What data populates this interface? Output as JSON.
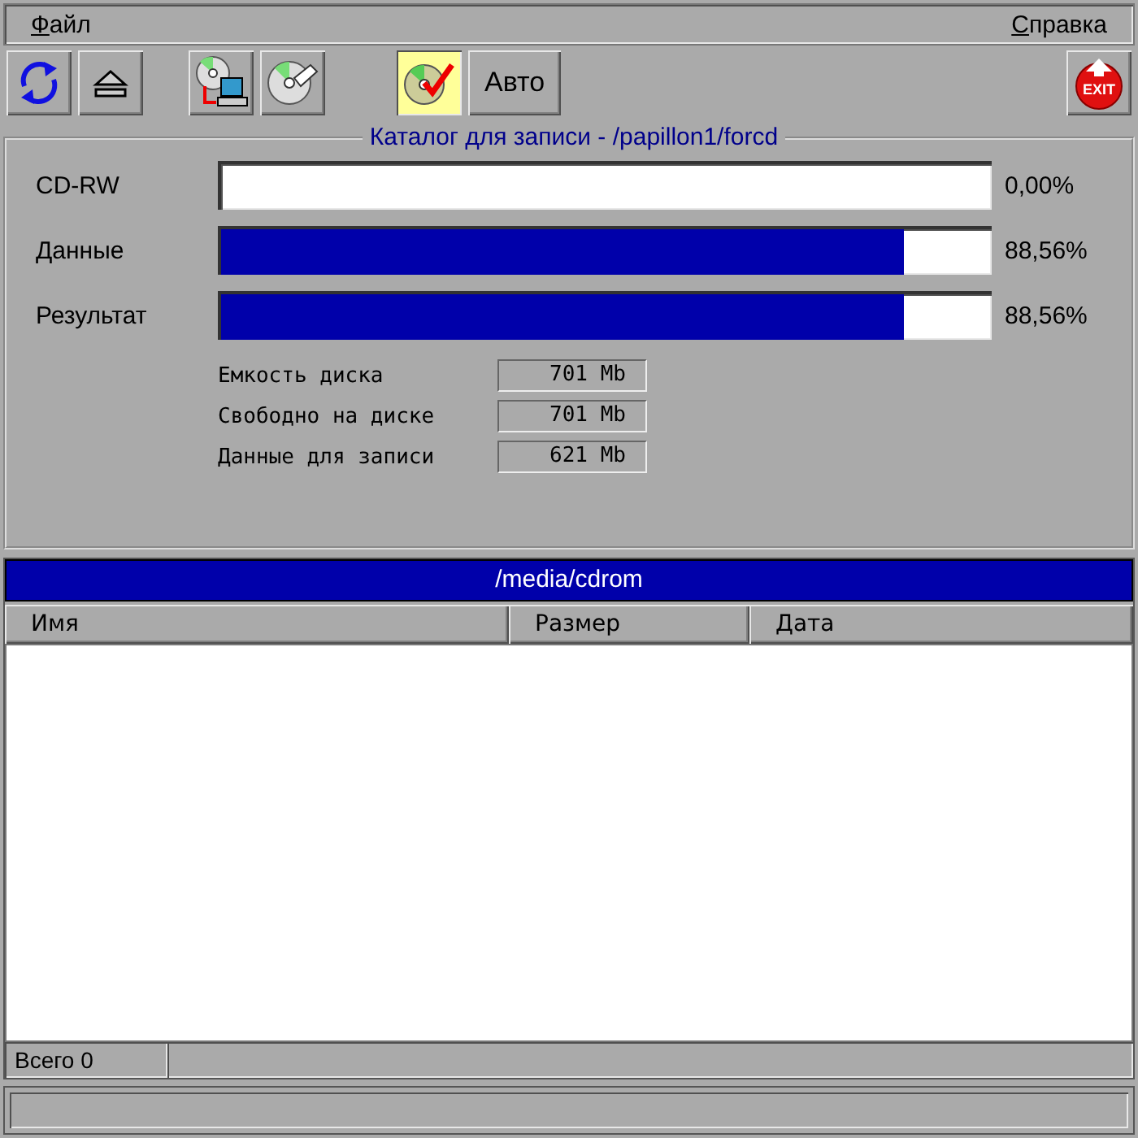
{
  "menu": [
    {
      "label": "Файл",
      "underline_first": true
    },
    {
      "label": "Справка",
      "underline_first": true
    }
  ],
  "toolbar": [
    {
      "kind": "refresh",
      "pressed": false
    },
    {
      "kind": "eject",
      "pressed": false
    },
    {
      "kind": "gap"
    },
    {
      "kind": "copy",
      "pressed": false
    },
    {
      "kind": "burn",
      "pressed": false
    },
    {
      "kind": "gap"
    },
    {
      "kind": "verify",
      "pressed": true
    },
    {
      "kind": "text",
      "label": "Авто",
      "pressed": false
    },
    {
      "kind": "spacer"
    },
    {
      "kind": "exit",
      "label": "EXIT",
      "pressed": false
    }
  ],
  "catalog": {
    "title": "Каталог для записи - /papillon1/forcd",
    "bars": [
      {
        "label": "CD-RW",
        "level": 0,
        "reading": "0,00%"
      },
      {
        "label": "Данные",
        "level": 0.8856,
        "reading": "88,56%"
      },
      {
        "label": "Результат",
        "level": 0.8856,
        "reading": "88,56%"
      }
    ],
    "stats": [
      {
        "label": "Емкость диска",
        "value": "701 Mb"
      },
      {
        "label": "Свободно на диске",
        "value": "701 Mb"
      },
      {
        "label": "Данные для записи",
        "value": "621 Mb"
      }
    ]
  },
  "file_list": {
    "path": "/media/cdrom",
    "columns": [
      "Имя",
      "Размер",
      "Дата"
    ]
  },
  "status_bar": {
    "count": "Всего 0"
  }
}
